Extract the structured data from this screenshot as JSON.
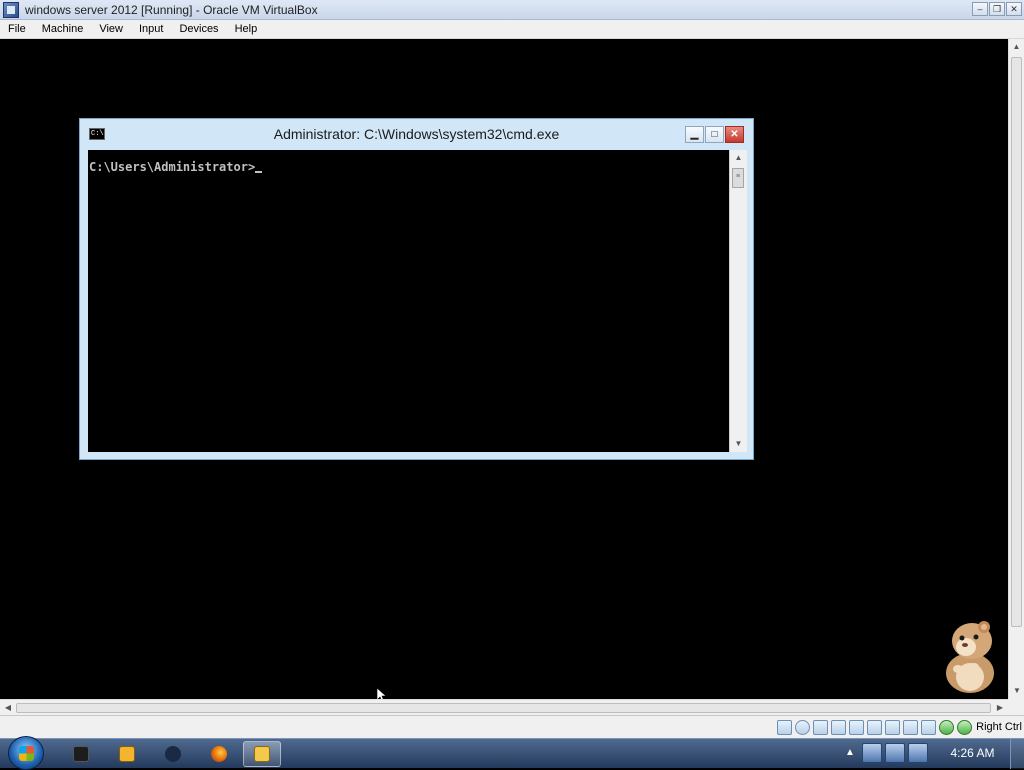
{
  "vbox": {
    "title": "windows server 2012 [Running] - Oracle VM VirtualBox",
    "menu": [
      "File",
      "Machine",
      "View",
      "Input",
      "Devices",
      "Help"
    ],
    "window_buttons": {
      "minimize": "–",
      "restore": "❐",
      "close": "✕"
    },
    "host_key": "Right Ctrl"
  },
  "cmd": {
    "title": "Administrator: C:\\Windows\\system32\\cmd.exe",
    "icon_text": "C:\\",
    "prompt": "C:\\Users\\Administrator>",
    "buttons": {
      "minimize": "▁",
      "maximize": "□",
      "close": "✕"
    }
  },
  "scroll_arrows": {
    "up": "▲",
    "down": "▼",
    "left": "◀",
    "right": "▶",
    "grip": "≡"
  },
  "taskbar": {
    "clock": "4:26 AM",
    "tray_arrow": "▲",
    "apps": [
      {
        "icon": "virtualbox-icon",
        "color": "#1d1d1d"
      },
      {
        "icon": "media-player-icon",
        "color": "#f3b431"
      },
      {
        "icon": "blue-ball-icon",
        "color": "#1a2a45"
      },
      {
        "icon": "firefox-icon",
        "color": "#e66000"
      },
      {
        "icon": "locked-folder-icon",
        "color": "#f2c94c"
      }
    ]
  }
}
